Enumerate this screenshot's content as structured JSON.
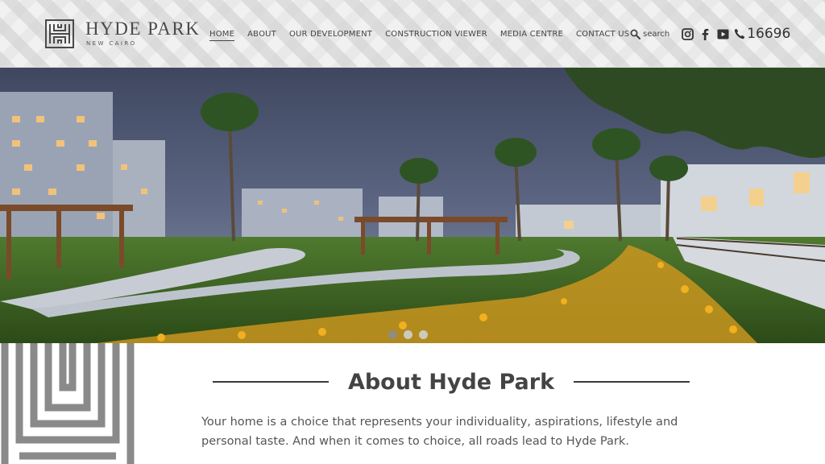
{
  "brand": {
    "name": "HYDE PARK",
    "subtitle": "NEW CAIRO"
  },
  "nav": {
    "items": [
      {
        "label": "HOME",
        "active": true
      },
      {
        "label": "ABOUT"
      },
      {
        "label": "OUR DEVELOPMENT"
      },
      {
        "label": "CONSTRUCTION VIEWER"
      },
      {
        "label": "MEDIA CENTRE"
      },
      {
        "label": "CONTACT US"
      }
    ]
  },
  "tools": {
    "search_label": "search",
    "search_icon": "magnifier-icon",
    "social_icons": [
      "instagram-icon",
      "facebook-icon",
      "youtube-icon"
    ],
    "phone_icon": "phone-icon",
    "phone": "16696"
  },
  "hero": {
    "slides_count": 3,
    "active_slide": 1
  },
  "about": {
    "title": "About Hyde Park",
    "text": "Your home is a choice that represents your individuality, aspirations, lifestyle and personal taste. And when it comes to choice, all roads lead to Hyde Park."
  },
  "colors": {
    "text": "#444444",
    "header_bg": "#f1f1f1",
    "sky": "#4a5570",
    "grass": "#3f6b25",
    "flowers": "#e3a21b"
  }
}
